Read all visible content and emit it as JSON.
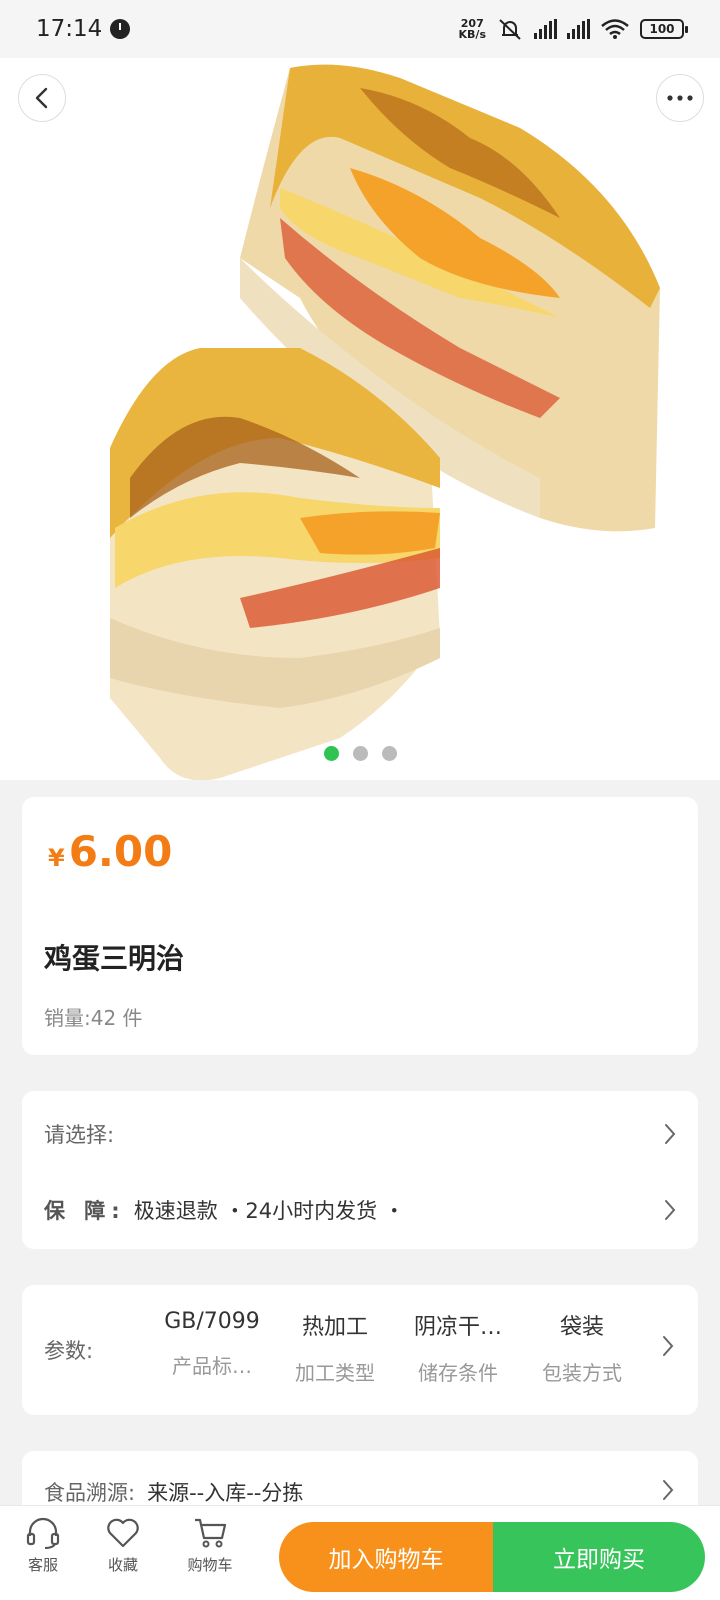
{
  "status_bar": {
    "time": "17:14",
    "net_speed_value": "207",
    "net_speed_unit": "KB/s",
    "battery": "100"
  },
  "product": {
    "currency": "¥",
    "price": "6.00",
    "name": "鸡蛋三明治",
    "sales": "销量:42 件",
    "image_count": 3,
    "image_active_index": 0
  },
  "options": {
    "select_label": "请选择:",
    "guarantee_label": "保 障:",
    "guarantee_value": "极速退款 ・24小时内发货 ・"
  },
  "params": {
    "label": "参数:",
    "items": [
      {
        "value": "GB/7099",
        "key": "产品标…"
      },
      {
        "value": "热加工",
        "key": "加工类型"
      },
      {
        "value": "阴凉干…",
        "key": "储存条件"
      },
      {
        "value": "袋装",
        "key": "包装方式"
      }
    ]
  },
  "trace": {
    "label": "食品溯源:",
    "value": "来源--入库--分拣"
  },
  "bottom_nav": {
    "service": "客服",
    "favorite": "收藏",
    "cart": "购物车",
    "add_to_cart": "加入购物车",
    "buy_now": "立即购买"
  },
  "colors": {
    "price": "#f47c15",
    "add_to_cart_bg": "#f7911b",
    "buy_now_bg": "#37c55b",
    "active_dot": "#2fc452"
  }
}
